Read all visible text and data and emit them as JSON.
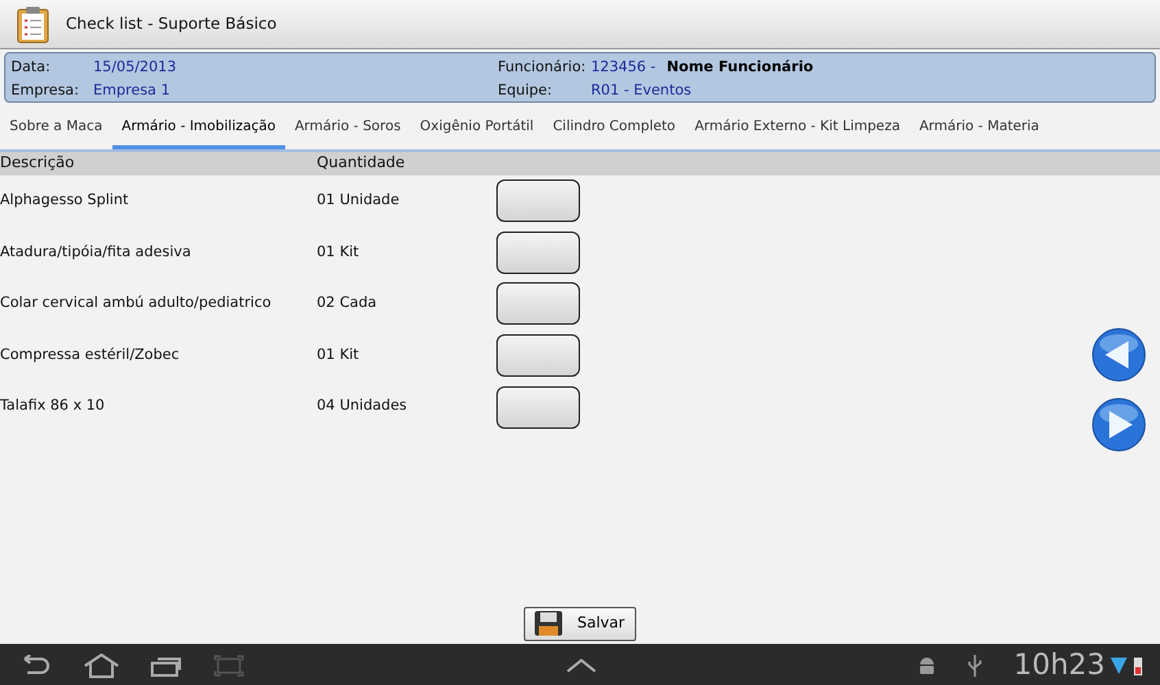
{
  "window": {
    "title": "Check list - Suporte Básico"
  },
  "header": {
    "data_label": "Data:",
    "data_value": "15/05/2013",
    "empresa_label": "Empresa:",
    "empresa_value": "Empresa 1",
    "funcionario_label": "Funcionário:",
    "funcionario_id": "123456 -",
    "funcionario_name": "Nome Funcionário",
    "equipe_label": "Equipe:",
    "equipe_value": "R01 - Eventos"
  },
  "tabs": [
    {
      "label": "Sobre a Maca",
      "selected": false
    },
    {
      "label": "Armário - Imobilização",
      "selected": true
    },
    {
      "label": "Armário - Soros",
      "selected": false
    },
    {
      "label": "Oxigênio Portátil",
      "selected": false
    },
    {
      "label": "Cilindro Completo",
      "selected": false
    },
    {
      "label": "Armário Externo - Kit Limpeza",
      "selected": false
    },
    {
      "label": "Armário - Materia",
      "selected": false
    }
  ],
  "table": {
    "columns": [
      "Descrição",
      "Quantidade"
    ],
    "rows": [
      {
        "description": "Alphagesso Splint",
        "quantity": "01 Unidade",
        "checked": false
      },
      {
        "description": "Atadura/tipóia/fita adesiva",
        "quantity": "01 Kit",
        "checked": false
      },
      {
        "description": "Colar cervical ambú adulto/pediatrico",
        "quantity": "02 Cada",
        "checked": false
      },
      {
        "description": "Compressa estéril/Zobec",
        "quantity": "01 Kit",
        "checked": false
      },
      {
        "description": "Talafix 86 x 10",
        "quantity": "04 Unidades",
        "checked": false
      }
    ]
  },
  "save_button": "Salvar",
  "status_bar": {
    "time": "10h23"
  }
}
